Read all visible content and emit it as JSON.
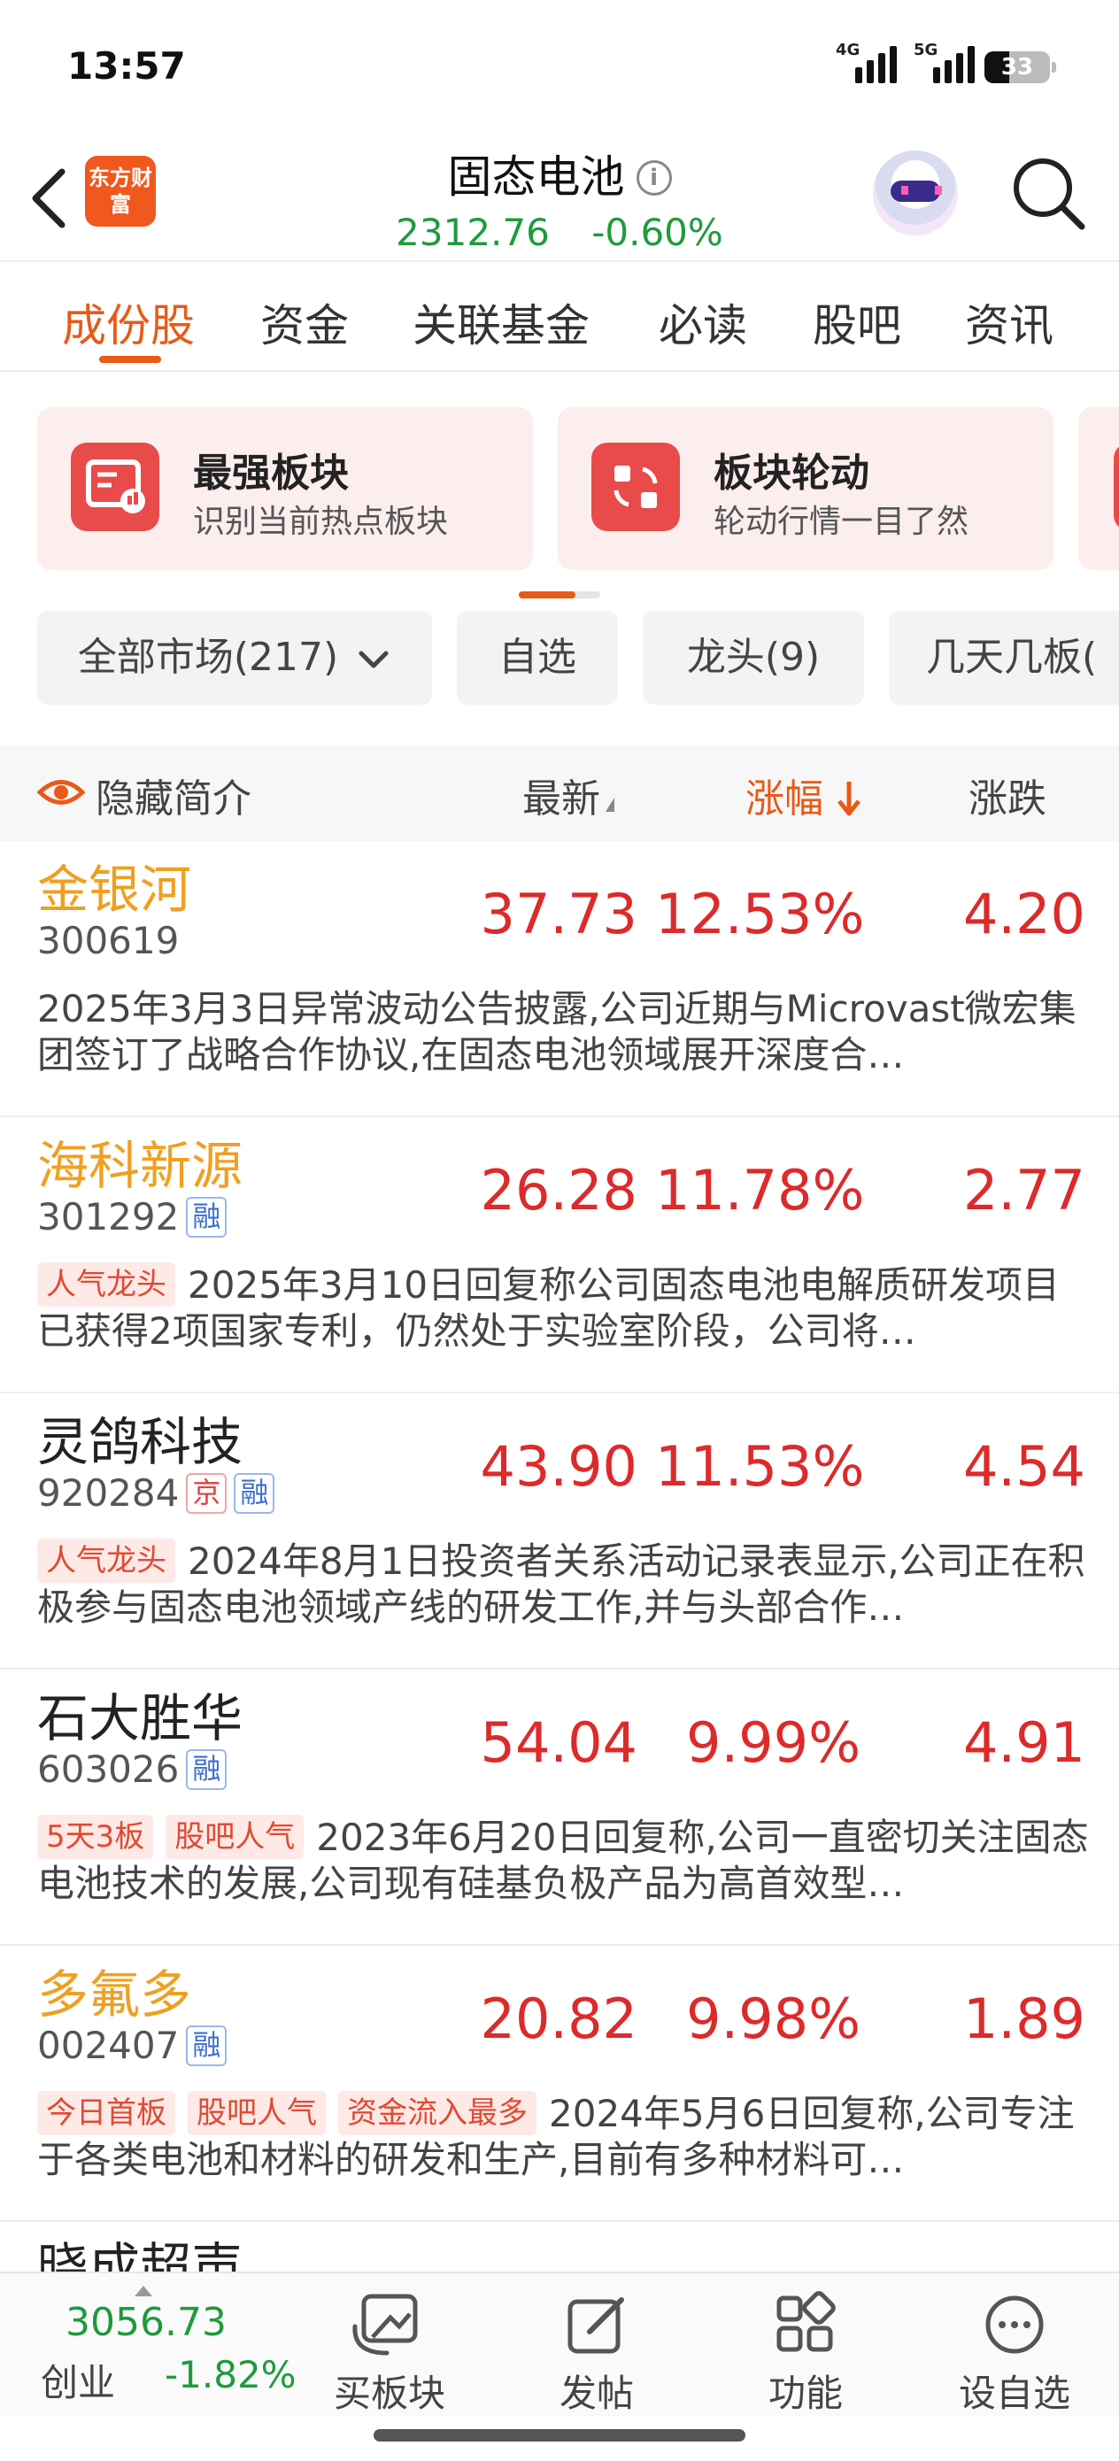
{
  "status_bar": {
    "time": "13:57",
    "signal1_label": "4G",
    "signal2_label": "5G",
    "battery": "33"
  },
  "header": {
    "logo_text": "东方财富",
    "title": "固态电池",
    "index_value": "2312.76",
    "index_change": "-0.60%"
  },
  "tabs": [
    "成份股",
    "资金",
    "关联基金",
    "必读",
    "股吧",
    "资讯"
  ],
  "active_tab": 0,
  "cards": [
    {
      "title": "最强板块",
      "subtitle": "识别当前热点板块"
    },
    {
      "title": "板块轮动",
      "subtitle": "轮动行情一目了然"
    }
  ],
  "filters": [
    "全部市场(217)",
    "自选",
    "龙头(9)",
    "几天几板("
  ],
  "table_header": {
    "hide_intro": "隐藏简介",
    "latest": "最新",
    "change_pct": "涨幅",
    "change": "涨跌"
  },
  "stocks": [
    {
      "name": "金银河",
      "code": "300619",
      "highlight": true,
      "badges": [],
      "price": "37.73",
      "pct": "12.53%",
      "chg": "4.20",
      "tags": [],
      "desc": "2025年3月3日异常波动公告披露,公司近期与Microvast微宏集团签订了战略合作协议,在固态电池领域展开深度合…"
    },
    {
      "name": "海科新源",
      "code": "301292",
      "highlight": true,
      "badges": [
        "融"
      ],
      "price": "26.28",
      "pct": "11.78%",
      "chg": "2.77",
      "tags": [
        "人气龙头"
      ],
      "desc": "2025年3月10日回复称公司固态电池电解质研发项目已获得2项国家专利，仍然处于实验室阶段，公司将…"
    },
    {
      "name": "灵鸽科技",
      "code": "920284",
      "highlight": false,
      "badges": [
        "京",
        "融"
      ],
      "price": "43.90",
      "pct": "11.53%",
      "chg": "4.54",
      "tags": [
        "人气龙头"
      ],
      "desc": "2024年8月1日投资者关系活动记录表显示,公司正在积极参与固态电池领域产线的研发工作,并与头部合作…"
    },
    {
      "name": "石大胜华",
      "code": "603026",
      "highlight": false,
      "badges": [
        "融"
      ],
      "price": "54.04",
      "pct": "9.99%",
      "chg": "4.91",
      "tags": [
        "5天3板",
        "股吧人气"
      ],
      "desc": "2023年6月20日回复称,公司一直密切关注固态电池技术的发展,公司现有硅基负极产品为高首效型…"
    },
    {
      "name": "多氟多",
      "code": "002407",
      "highlight": true,
      "badges": [
        "融"
      ],
      "price": "20.82",
      "pct": "9.98%",
      "chg": "1.89",
      "tags": [
        "今日首板",
        "股吧人气",
        "资金流入最多"
      ],
      "desc": "2024年5月6日回复称,公司专注于各类电池和材料的研发和生产,目前有多种材料可…"
    }
  ],
  "partial_row_name": "晓成超声",
  "bottom_bar": {
    "index_value": "3056.73",
    "index_name": "创业",
    "index_change": "-1.82%",
    "items": [
      {
        "label": "买板块",
        "icon": "buy-sector-icon"
      },
      {
        "label": "发帖",
        "icon": "compose-icon"
      },
      {
        "label": "功能",
        "icon": "grid-icon"
      },
      {
        "label": "设自选",
        "icon": "more-dots-icon"
      }
    ]
  },
  "colors": {
    "accent": "#e85a17",
    "up": "#dd2a2a",
    "down": "#1e9b3c",
    "highlight_name": "#f0a020"
  }
}
